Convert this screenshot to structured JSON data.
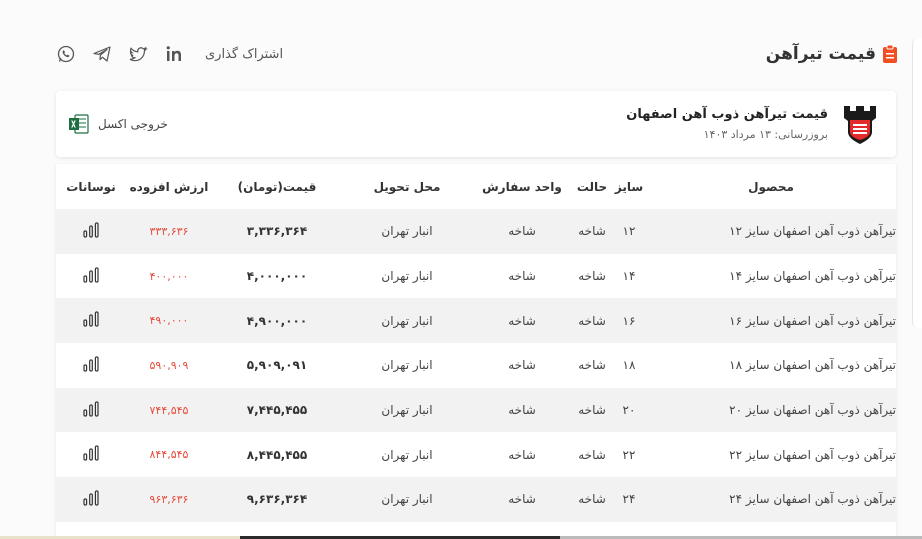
{
  "header": {
    "title": "قیمت تیرآهن",
    "share_label": "اشتراک گذاری",
    "social": [
      "whatsapp-icon",
      "telegram-icon",
      "twitter-icon",
      "linkedin-icon"
    ]
  },
  "card": {
    "title": "قیمت تیرآهن ذوب آهن اصفهان",
    "updated": "بروزرسانی: ۱۳ مرداد ۱۴۰۳",
    "excel_label": "خروجی اکسل"
  },
  "colors": {
    "accent": "#f04e23",
    "vat_red": "#e74c3c",
    "row_alt": "#f2f2f2"
  },
  "table": {
    "headers": {
      "product": "محصول",
      "size": "سایز",
      "state": "حالت",
      "unit": "واحد سفارش",
      "delivery": "محل تحویل",
      "price": "قیمت(تومان)",
      "vat": "ارزش افزوده",
      "chart": "نوسانات"
    },
    "rows": [
      {
        "product": "تیرآهن ذوب آهن اصفهان سایز ۱۲",
        "size": "۱۲",
        "state": "شاخه",
        "unit": "شاخه",
        "delivery": "انبار تهران",
        "price": "۳,۳۳۶,۳۶۴",
        "vat": "۳۳۳,۶۳۶"
      },
      {
        "product": "تیرآهن ذوب آهن اصفهان سایز ۱۴",
        "size": "۱۴",
        "state": "شاخه",
        "unit": "شاخه",
        "delivery": "انبار تهران",
        "price": "۴,۰۰۰,۰۰۰",
        "vat": "۴۰۰,۰۰۰"
      },
      {
        "product": "تیرآهن ذوب آهن اصفهان سایز ۱۶",
        "size": "۱۶",
        "state": "شاخه",
        "unit": "شاخه",
        "delivery": "انبار تهران",
        "price": "۴,۹۰۰,۰۰۰",
        "vat": "۴۹۰,۰۰۰"
      },
      {
        "product": "تیرآهن ذوب آهن اصفهان سایز ۱۸",
        "size": "۱۸",
        "state": "شاخه",
        "unit": "شاخه",
        "delivery": "انبار تهران",
        "price": "۵,۹۰۹,۰۹۱",
        "vat": "۵۹۰,۹۰۹"
      },
      {
        "product": "تیرآهن ذوب آهن اصفهان سایز ۲۰",
        "size": "۲۰",
        "state": "شاخه",
        "unit": "شاخه",
        "delivery": "انبار تهران",
        "price": "۷,۴۴۵,۴۵۵",
        "vat": "۷۴۴,۵۴۵"
      },
      {
        "product": "تیرآهن ذوب آهن اصفهان سایز ۲۲",
        "size": "۲۲",
        "state": "شاخه",
        "unit": "شاخه",
        "delivery": "انبار تهران",
        "price": "۸,۴۴۵,۴۵۵",
        "vat": "۸۴۴,۵۴۵"
      },
      {
        "product": "تیرآهن ذوب آهن اصفهان سایز ۲۴",
        "size": "۲۴",
        "state": "شاخه",
        "unit": "شاخه",
        "delivery": "انبار تهران",
        "price": "۹,۶۳۶,۳۶۴",
        "vat": "۹۶۳,۶۳۶"
      }
    ]
  }
}
